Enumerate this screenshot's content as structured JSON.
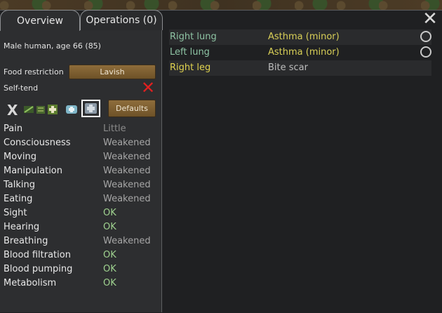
{
  "tabs": [
    {
      "label": "Overview"
    },
    {
      "label": "Operations (0)"
    }
  ],
  "pawn": {
    "description": "Male human, age 66 (85)"
  },
  "food_restriction": {
    "label": "Food restriction",
    "value": "Lavish"
  },
  "self_tend": {
    "label": "Self-tend"
  },
  "care": {
    "x_label": "X",
    "defaults_label": "Defaults"
  },
  "capacities": [
    {
      "name": "Pain",
      "value": "Little",
      "color": "#8a8a8a"
    },
    {
      "name": "Consciousness",
      "value": "Weakened",
      "color": "#a6a6a6"
    },
    {
      "name": "Moving",
      "value": "Weakened",
      "color": "#a6a6a6"
    },
    {
      "name": "Manipulation",
      "value": "Weakened",
      "color": "#a6a6a6"
    },
    {
      "name": "Talking",
      "value": "Weakened",
      "color": "#a6a6a6"
    },
    {
      "name": "Eating",
      "value": "Weakened",
      "color": "#a6a6a6"
    },
    {
      "name": "Sight",
      "value": "OK",
      "color": "#9fd28f"
    },
    {
      "name": "Hearing",
      "value": "OK",
      "color": "#9fd28f"
    },
    {
      "name": "Breathing",
      "value": "Weakened",
      "color": "#a6a6a6"
    },
    {
      "name": "Blood filtration",
      "value": "OK",
      "color": "#9fd28f"
    },
    {
      "name": "Blood pumping",
      "value": "OK",
      "color": "#9fd28f"
    },
    {
      "name": "Metabolism",
      "value": "OK",
      "color": "#9fd28f"
    }
  ],
  "health": [
    {
      "part": "Right lung",
      "condition": "Asthma (minor)",
      "part_color": "#8ec4a4",
      "cond_color": "#d8cf57",
      "icon": "ring-icon"
    },
    {
      "part": "Left lung",
      "condition": "Asthma (minor)",
      "part_color": "#8ec4a4",
      "cond_color": "#d8cf57",
      "icon": "ring-icon"
    },
    {
      "part": "Right leg",
      "condition": "Bite scar",
      "part_color": "#e0d34f",
      "cond_color": "#bdbdbd",
      "icon": ""
    }
  ]
}
